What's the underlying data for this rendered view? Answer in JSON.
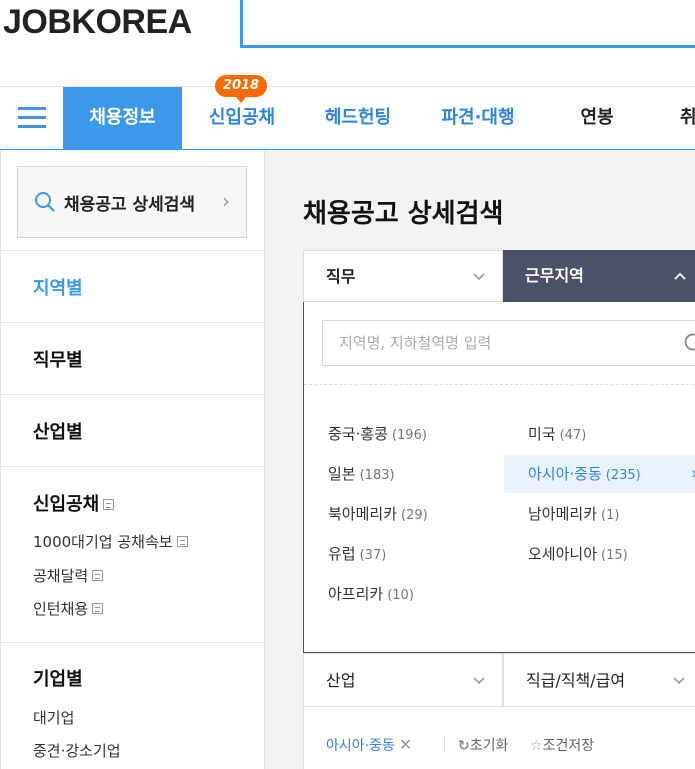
{
  "brand": {
    "logo": "JOBKOREA"
  },
  "gnb": {
    "tabs": [
      {
        "label": "채용정보"
      },
      {
        "label": "신입공채",
        "badge": "2018"
      },
      {
        "label": "헤드헌팅"
      },
      {
        "label": "파견·대행"
      },
      {
        "label": "연봉"
      },
      {
        "label": "취"
      }
    ]
  },
  "sidebar": {
    "search_label": "채용공고 상세검색",
    "sections": {
      "region": "지역별",
      "job": "직무별",
      "industry": "산업별",
      "newgrad": {
        "title": "신입공채",
        "items": [
          "1000대기업 공채속보",
          "공채달력",
          "인턴채용"
        ]
      },
      "company": {
        "title": "기업별",
        "items": [
          "대기업",
          "중견·강소기업"
        ]
      }
    }
  },
  "main": {
    "title": "채용공고 상세검색",
    "filters": {
      "job": "직무",
      "region": "근무지역",
      "industry": "산업",
      "rank": "직급/직책/급여"
    },
    "search_placeholder": "지역명, 지하철역명 입력",
    "regions": [
      {
        "name": "중국·홍콩",
        "count": "(196)"
      },
      {
        "name": "미국",
        "count": "(47)"
      },
      {
        "name": "일본",
        "count": "(183)"
      },
      {
        "name": "아시아·중동",
        "count": "(235)",
        "selected": true
      },
      {
        "name": "북아메리카",
        "count": "(29)"
      },
      {
        "name": "남아메리카",
        "count": "(1)"
      },
      {
        "name": "유럽",
        "count": "(37)"
      },
      {
        "name": "오세아니아",
        "count": "(15)"
      },
      {
        "name": "아프리카",
        "count": "(10)"
      }
    ],
    "selected_chip": "아시아·중동",
    "reset_label": "초기화",
    "save_label": "조건저장"
  },
  "colors": {
    "accent": "#3c98ea",
    "dark_tab": "#4a5168",
    "badge": "#ff6a00"
  }
}
